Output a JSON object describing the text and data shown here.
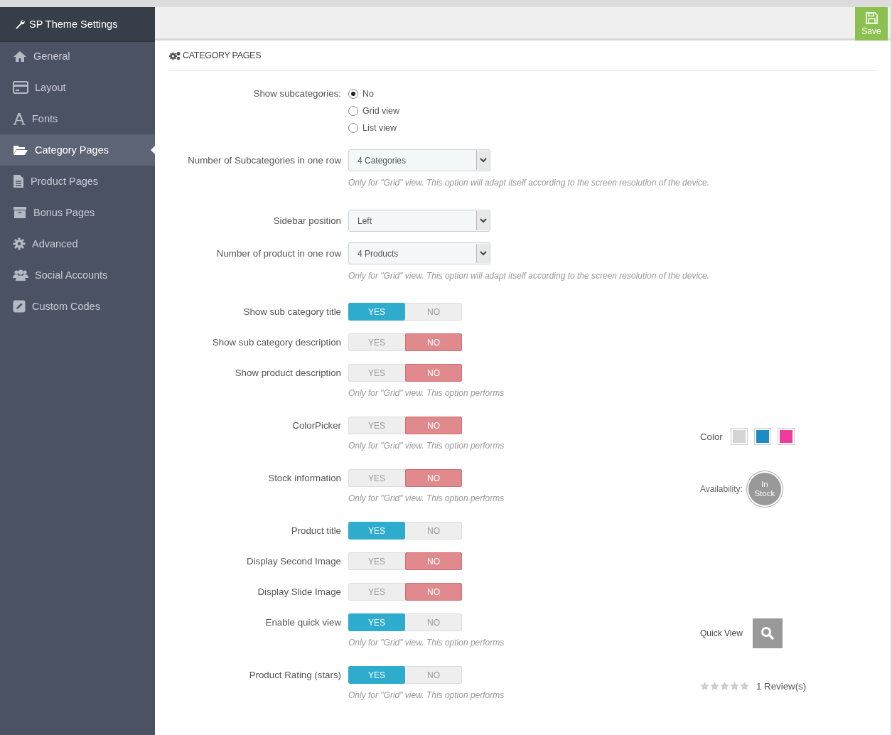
{
  "sidebar": {
    "title": "SP Theme Settings",
    "items": [
      {
        "label": "General",
        "selected": false
      },
      {
        "label": "Layout",
        "selected": false
      },
      {
        "label": "Fonts",
        "selected": false
      },
      {
        "label": "Category Pages",
        "selected": true
      },
      {
        "label": "Product Pages",
        "selected": false
      },
      {
        "label": "Bonus Pages",
        "selected": false
      },
      {
        "label": "Advanced",
        "selected": false
      },
      {
        "label": "Social Accounts",
        "selected": false
      },
      {
        "label": "Custom Codes",
        "selected": false
      }
    ]
  },
  "toolbar": {
    "save": "Save"
  },
  "panel": {
    "title": "CATEGORY PAGES",
    "rows": [
      {
        "kind": "radio",
        "label": "Show subcategories:",
        "options": [
          {
            "label": "No",
            "selected": true
          },
          {
            "label": "Grid view",
            "selected": false
          },
          {
            "label": "List view",
            "selected": false
          }
        ]
      },
      {
        "kind": "select",
        "label": "Number of Subcategories in one row",
        "value": "4 Categories",
        "help": "Only for \"Grid\" view. This option will adapt itself according to the screen resolution of the device."
      },
      {
        "kind": "select",
        "label": "Sidebar position",
        "value": "Left"
      },
      {
        "kind": "select",
        "label": "Number of product in one row",
        "value": "4 Products",
        "help": "Only for \"Grid\" view. This option will adapt itself according to the screen resolution of the device."
      },
      {
        "kind": "toggle",
        "label": "Show sub category title",
        "yes": "YES",
        "no": "NO",
        "on": true
      },
      {
        "kind": "toggle",
        "label": "Show sub category description",
        "yes": "YES",
        "no": "NO",
        "on": false
      },
      {
        "kind": "toggle",
        "label": "Show product description",
        "yes": "YES",
        "no": "NO",
        "on": false,
        "help": "Only for \"Grid\" view. This option performs"
      },
      {
        "kind": "toggle",
        "label": "ColorPicker",
        "yes": "YES",
        "no": "NO",
        "on": false,
        "help": "Only for \"Grid\" view. This option performs",
        "preview": {
          "kind": "colors",
          "label": "Color",
          "swatches": [
            {
              "color": "#d3d6d5"
            },
            {
              "color": "#1e8bc3"
            },
            {
              "color": "#ef3a9e"
            }
          ]
        }
      },
      {
        "kind": "toggle",
        "label": "Stock information",
        "yes": "YES",
        "no": "NO",
        "on": false,
        "help": "Only for \"Grid\" view. This option performs",
        "preview": {
          "kind": "stock",
          "label": "Availability:",
          "badge": "In Stock"
        }
      },
      {
        "kind": "toggle",
        "label": "Product title",
        "yes": "YES",
        "no": "NO",
        "on": true
      },
      {
        "kind": "toggle",
        "label": "Display Second Image",
        "yes": "YES",
        "no": "NO",
        "on": false
      },
      {
        "kind": "toggle",
        "label": "Display Slide Image",
        "yes": "YES",
        "no": "NO",
        "on": false
      },
      {
        "kind": "toggle",
        "label": "Enable quick view",
        "yes": "YES",
        "no": "NO",
        "on": true,
        "help": "Only for \"Grid\" view. This option performs",
        "preview": {
          "kind": "quickview",
          "label": "Quick View"
        }
      },
      {
        "kind": "toggle",
        "label": "Product Rating (stars)",
        "yes": "YES",
        "no": "NO",
        "on": true,
        "help": "Only for \"Grid\" view. This option performs",
        "preview": {
          "kind": "rating",
          "stars": 0,
          "label": "1 Review(s)"
        }
      }
    ]
  }
}
